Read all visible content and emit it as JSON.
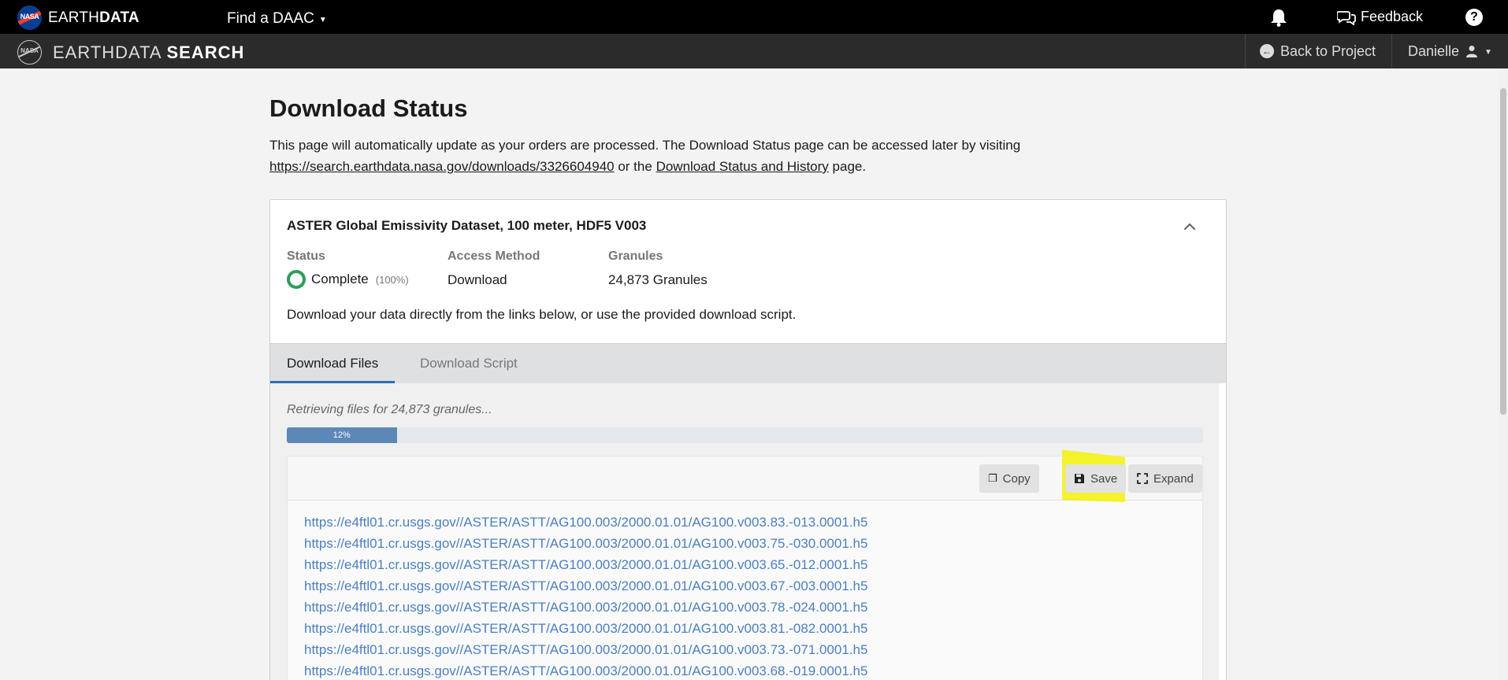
{
  "topbar": {
    "nasa_logo_text": "NASA",
    "brand_light": "EARTH",
    "brand_bold": "DATA",
    "find_daac": "Find a DAAC",
    "feedback": "Feedback",
    "help": "?"
  },
  "subbar": {
    "app_light": "EARTHDATA",
    "app_bold": "SEARCH",
    "back_to_project": "Back to Project",
    "user_name": "Danielle"
  },
  "page": {
    "title": "Download Status",
    "intro_text_1": "This page will automatically update as your orders are processed. The Download Status page can be accessed later by visiting",
    "intro_link": "https://search.earthdata.nasa.gov/downloads/3326604940",
    "intro_text_2": "or the",
    "history_link": "Download Status and History",
    "intro_text_3": "page."
  },
  "dataset": {
    "title": "ASTER Global Emissivity Dataset, 100 meter, HDF5 V003",
    "status_label": "Status",
    "status_value": "Complete",
    "status_percent": "(100%)",
    "access_label": "Access Method",
    "access_value": "Download",
    "granules_label": "Granules",
    "granules_value": "24,873 Granules",
    "note": "Download your data directly from the links below, or use the provided download script."
  },
  "tabs": [
    {
      "label": "Download Files",
      "active": true
    },
    {
      "label": "Download Script",
      "active": false
    }
  ],
  "files": {
    "retrieving": "Retrieving files for 24,873 granules...",
    "progress_label": "12%",
    "progress_fraction": 0.12,
    "copy": "Copy",
    "save": "Save",
    "expand": "Expand",
    "urls": [
      "https://e4ftl01.cr.usgs.gov//ASTER/ASTT/AG100.003/2000.01.01/AG100.v003.83.-013.0001.h5",
      "https://e4ftl01.cr.usgs.gov//ASTER/ASTT/AG100.003/2000.01.01/AG100.v003.75.-030.0001.h5",
      "https://e4ftl01.cr.usgs.gov//ASTER/ASTT/AG100.003/2000.01.01/AG100.v003.65.-012.0001.h5",
      "https://e4ftl01.cr.usgs.gov//ASTER/ASTT/AG100.003/2000.01.01/AG100.v003.67.-003.0001.h5",
      "https://e4ftl01.cr.usgs.gov//ASTER/ASTT/AG100.003/2000.01.01/AG100.v003.78.-024.0001.h5",
      "https://e4ftl01.cr.usgs.gov//ASTER/ASTT/AG100.003/2000.01.01/AG100.v003.81.-082.0001.h5",
      "https://e4ftl01.cr.usgs.gov//ASTER/ASTT/AG100.003/2000.01.01/AG100.v003.73.-071.0001.h5",
      "https://e4ftl01.cr.usgs.gov//ASTER/ASTT/AG100.003/2000.01.01/AG100.v003.68.-019.0001.h5"
    ]
  },
  "colors": {
    "accent": "#2e6db4",
    "complete": "#2d9e5a",
    "link": "#4a7fc0",
    "highlight": "#f4f10a"
  },
  "icons": [
    "bell-icon",
    "feedback-icon",
    "help-icon",
    "back-arrow-icon",
    "user-icon",
    "chevron-up-icon",
    "status-ring-icon",
    "copy-icon",
    "save-icon",
    "expand-icon"
  ]
}
